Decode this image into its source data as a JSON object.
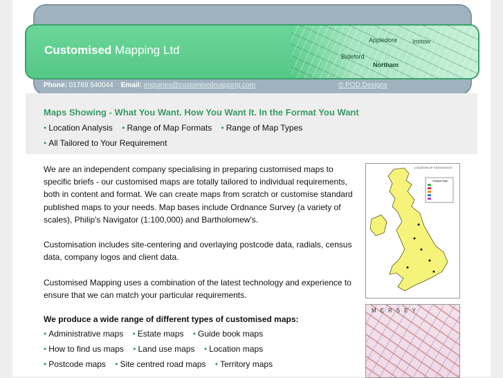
{
  "header": {
    "title_bold": "Customised",
    "title_rest": "Mapping Ltd",
    "map_labels": [
      "Appledore",
      "Instow",
      "Northam",
      "Bideford"
    ],
    "phone_label": "Phone:",
    "phone_value": "01769 540044",
    "email_label": "Email:",
    "email_value": "enquiries@customisedmapping.com",
    "credit": "© POD Designs"
  },
  "intro": {
    "headline": "Maps Showing - What You Want. How You Want It. In the Format You Want",
    "bullets_row1": [
      "Location Analysis",
      "Range of Map Formats",
      "Range of Map Types"
    ],
    "bullets_row2": [
      "All Tailored to Your Requirement"
    ]
  },
  "body": {
    "para1": "We are an independent company specialising in preparing customised maps to specific briefs - our customised maps are totally tailored to individual requirements, both in content and format. We can create maps from scratch or customise standard published maps to your needs. Map bases include Ordnance Survey (a variety of scales), Philip's Navigator (1:100,000) and Bartholomew's.",
    "para2": "Customisation includes site-centering and overlaying postcode data, radials, census data, company logos and client data.",
    "para3": "Customised Mapping uses a combination of the latest technology and experience to ensure that we can match your particular requirements.",
    "subhead": "We produce a wide range of different types of customised maps:",
    "types_row1": [
      "Administrative maps",
      "Estate maps",
      "Guide book maps"
    ],
    "types_row2": [
      "How to find us maps",
      "Land use maps",
      "Location maps"
    ],
    "types_row3": [
      "Postcode maps",
      "Site centred road maps",
      "Territory maps"
    ]
  },
  "images": {
    "uk_map_title": "LOCATION OF XXXXXXXXXX",
    "uk_map_key": "Sample Map",
    "street_map_title": "MERSEY"
  },
  "colors": {
    "accent_green": "#3a9a66",
    "header_green": "#55c886",
    "header_grey": "#9fb3bf"
  }
}
